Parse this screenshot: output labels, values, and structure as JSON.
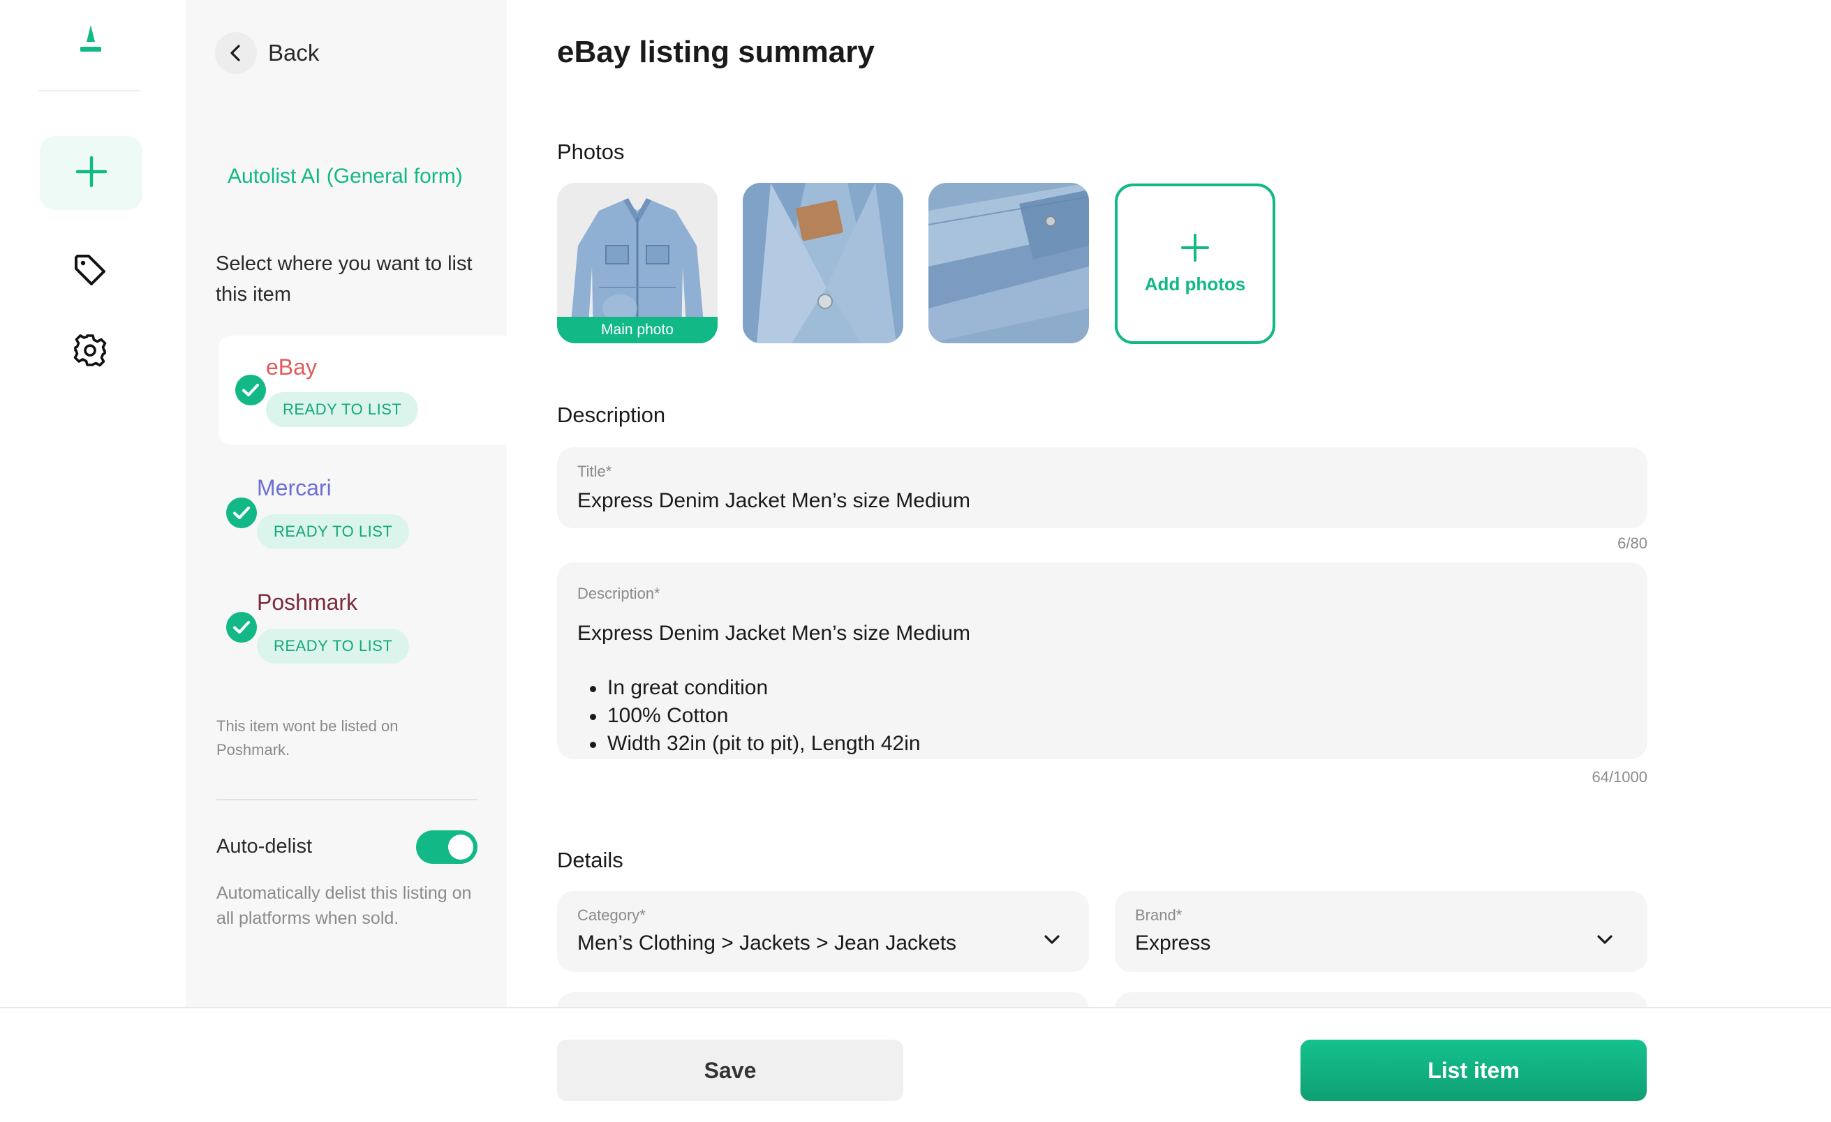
{
  "app": {
    "logo_icon": "autolist-logo-icon",
    "brand_color": "#12b886"
  },
  "rail": {
    "items": [
      {
        "name": "add",
        "icon": "plus-icon"
      },
      {
        "name": "listings",
        "icon": "tag-icon"
      },
      {
        "name": "settings",
        "icon": "gear-icon"
      }
    ]
  },
  "side": {
    "back_label": "Back",
    "form_link": "Autolist AI (General form)",
    "prompt": "Select where you want to list this item",
    "marketplaces": [
      {
        "name": "eBay",
        "color": "#e05a5a",
        "status": "READY TO LIST",
        "selected": true
      },
      {
        "name": "Mercari",
        "color": "#6b6fd6",
        "status": "READY TO LIST",
        "selected": false
      },
      {
        "name": "Poshmark",
        "color": "#7a2a3a",
        "status": "READY TO LIST",
        "selected": false
      }
    ],
    "note": "This item wont be listed on Poshmark.",
    "auto_delist": {
      "label": "Auto-delist",
      "enabled": true,
      "description": "Automatically delist this listing on all platforms when sold."
    }
  },
  "main": {
    "title": "eBay listing summary",
    "photos_section": "Photos",
    "main_photo_label": "Main photo",
    "add_photos_label": "Add photos",
    "description_section": "Description",
    "title_field": {
      "label": "Title*",
      "value": "Express Denim Jacket Men’s size Medium",
      "counter": "6/80"
    },
    "description_field": {
      "label": "Description*",
      "heading": "Express Denim Jacket Men’s size Medium",
      "bullets": [
        "In great condition",
        "100% Cotton",
        "Width 32in (pit to pit), Length 42in"
      ],
      "counter": "64/1000"
    },
    "details_section": "Details",
    "category_field": {
      "label": "Category*",
      "value": "Men’s Clothing > Jackets > Jean Jackets"
    },
    "brand_field": {
      "label": "Brand*",
      "value": "Express"
    }
  },
  "actions": {
    "save_label": "Save",
    "list_label": "List item"
  }
}
